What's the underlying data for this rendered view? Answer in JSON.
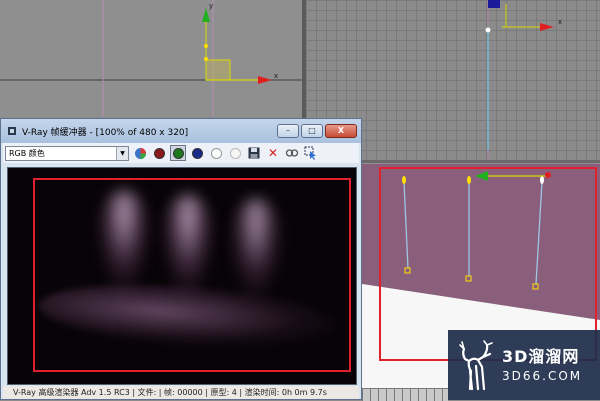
{
  "viewports": {
    "top_left": {
      "axis_x_label": "x",
      "axis_y_label": "y"
    },
    "top_right": {
      "axis_x_label": "x"
    }
  },
  "vfb": {
    "title": "V-Ray 帧缓冲器 - [100% of 480 x 320]",
    "window_buttons": {
      "minimize": "–",
      "restore": "□",
      "close": "X"
    },
    "toolbar": {
      "channel_value": "RGB 颜色",
      "color_buttons": [
        {
          "name": "rgb-channels",
          "color": "#ffffff",
          "pressed": false
        },
        {
          "name": "red-channel",
          "color": "#8b1a1a",
          "pressed": false
        },
        {
          "name": "green-channel",
          "color": "#1c7a1c",
          "pressed": true
        },
        {
          "name": "blue-channel",
          "color": "#1a2a8b",
          "pressed": false
        },
        {
          "name": "alpha-channel",
          "color": "#ffffff",
          "pressed": false
        },
        {
          "name": "mono-channel",
          "color": "#f4f4f4",
          "pressed": false
        }
      ]
    },
    "status_text": "V-Ray 高级渲染器 Adv 1.5 RC3 | 文件: | 帧: 00000 | 原型: 4 | 渲染时间: 0h 0m 9.7s"
  },
  "colors": {
    "accent_red": "#e0202a",
    "light_glow": "#c7a2c6",
    "viewport_wall": "#8a5f7c"
  },
  "watermark": {
    "cn": "3D溜溜网",
    "url": "3D66.COM"
  }
}
